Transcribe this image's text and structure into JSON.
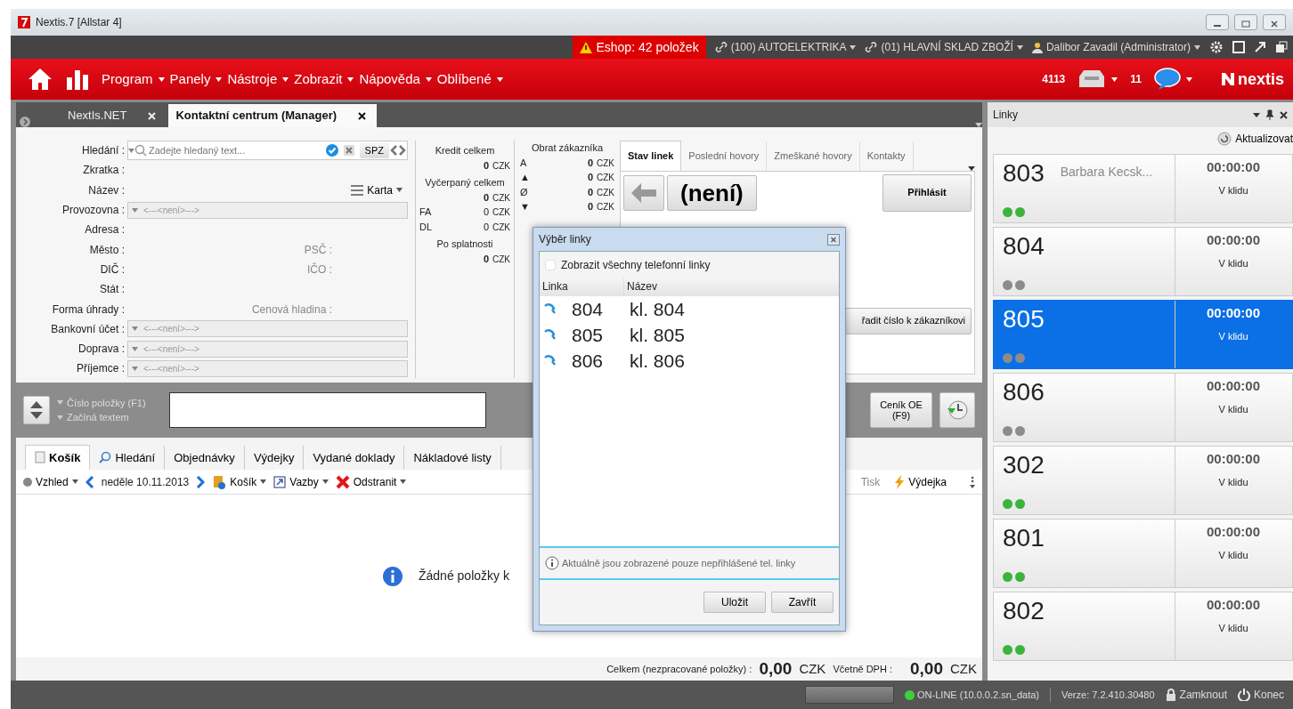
{
  "window": {
    "title": "Nextis.7 [Allstar 4]"
  },
  "top_strip": {
    "eshop": "Eshop: 42 položek",
    "links": [
      "(100) AUTOELEKTRIKA",
      "(01) HLAVNÍ SKLAD ZBOŽÍ"
    ],
    "user": "Dalibor Zavadil (Administrator)"
  },
  "menu": {
    "items": [
      "Program",
      "Panely",
      "Nástroje",
      "Zobrazit",
      "Nápověda",
      "Oblíbené"
    ],
    "counter": "4113",
    "messages": "11",
    "logo": "nextis"
  },
  "doc_tabs": [
    {
      "label": "NextIs.NET",
      "selected": false
    },
    {
      "label": "Kontaktní centrum (Manager)",
      "selected": true
    }
  ],
  "customer_form": {
    "search_label": "Hledání :",
    "search_placeholder": "Zadejte hledaný text...",
    "spz": "SPZ",
    "rows": [
      {
        "label": "Zkratka :",
        "kind": "plain"
      },
      {
        "label": "Název :",
        "kind": "plain",
        "action": "Karta"
      },
      {
        "label": "Provozovna :",
        "kind": "select",
        "value": "<---<není>--->"
      },
      {
        "label": "Adresa :",
        "kind": "plain"
      },
      {
        "label": "Město :",
        "kind": "plain",
        "right_label": "PSČ :"
      },
      {
        "label": "DIČ :",
        "kind": "plain",
        "right_label": "IČO :"
      },
      {
        "label": "Stát :",
        "kind": "plain"
      },
      {
        "label": "Forma úhrady :",
        "kind": "plain",
        "right_label": "Cenová hladina :"
      },
      {
        "label": "Bankovní účet :",
        "kind": "select",
        "value": "<---<není>--->"
      },
      {
        "label": "Doprava :",
        "kind": "select",
        "value": "<---<není>--->"
      },
      {
        "label": "Příjemce :",
        "kind": "select",
        "value": "<---<není>--->"
      }
    ]
  },
  "credit": [
    {
      "kind": "heading",
      "text": "Kredit celkem"
    },
    {
      "kind": "amount",
      "value": "0",
      "currency": "CZK"
    },
    {
      "kind": "heading",
      "text": "Vyčerpaný celkem"
    },
    {
      "kind": "amount",
      "value": "0",
      "currency": "CZK"
    },
    {
      "kind": "labeled",
      "label": "FA",
      "value": "0",
      "currency": "CZK"
    },
    {
      "kind": "labeled",
      "label": "DL",
      "value": "0",
      "currency": "CZK"
    },
    {
      "kind": "heading",
      "text": "Po splatnosti"
    },
    {
      "kind": "amount",
      "value": "0",
      "currency": "CZK"
    }
  ],
  "turnover": {
    "title": "Obrat zákazníka",
    "rows": [
      {
        "label": "A",
        "value": "0",
        "currency": "CZK"
      },
      {
        "label": "▲",
        "value": "0",
        "currency": "CZK"
      },
      {
        "label": "Ø",
        "value": "0",
        "currency": "CZK"
      },
      {
        "label": "▼",
        "value": "0",
        "currency": "CZK"
      }
    ]
  },
  "call_panel": {
    "tabs": [
      {
        "label": "Stav linek",
        "selected": true
      },
      {
        "label": "Poslední hovory",
        "selected": false
      },
      {
        "label": "Zmeškané hovory",
        "selected": false
      },
      {
        "label": "Kontakty",
        "selected": false
      }
    ],
    "line": "(není)",
    "login": "Přihlásit",
    "assign": "řadit číslo k zákazníkovi"
  },
  "item_entry": {
    "modes": [
      "Číslo položky (F1)",
      "Začíná textem"
    ],
    "price_list": "Ceník OE (F9)"
  },
  "bottom_tabs": [
    {
      "label": "Košík",
      "selected": true
    },
    {
      "label": "Hledání",
      "selected": false
    },
    {
      "label": "Objednávky",
      "selected": false
    },
    {
      "label": "Výdejky",
      "selected": false
    },
    {
      "label": "Vydané doklady",
      "selected": false
    },
    {
      "label": "Nákladové listy",
      "selected": false
    }
  ],
  "toolbar": {
    "view": "Vzhled",
    "date": "neděle 10.11.2013",
    "cart": "Košík",
    "links": "Vazby",
    "remove": "Odstranit",
    "print": "Tisk",
    "issue": "Výdejka"
  },
  "empty_message": "Žádné položky k",
  "totals": {
    "label": "Celkem (nezpracované položky) :",
    "amount": "0,00",
    "currency": "CZK",
    "vat_label": "Včetně DPH :",
    "vat_amount": "0,00",
    "vat_currency": "CZK"
  },
  "lines_panel": {
    "title": "Linky",
    "refresh": "Aktualizovat"
  },
  "lines": [
    {
      "number": "803",
      "name": "Barbara Kecsk...",
      "time": "00:00:00",
      "status": "V klidu",
      "color": "#3cb43c",
      "selected": false
    },
    {
      "number": "804",
      "time": "00:00:00",
      "status": "V klidu",
      "color": "#8c8c8c",
      "selected": false
    },
    {
      "number": "805",
      "time": "00:00:00",
      "status": "V klidu",
      "color": "#8c8c8c",
      "selected": true
    },
    {
      "number": "806",
      "time": "00:00:00",
      "status": "V klidu",
      "color": "#8c8c8c",
      "selected": false
    },
    {
      "number": "302",
      "time": "00:00:00",
      "status": "V klidu",
      "color": "#3cb43c",
      "selected": false
    },
    {
      "number": "801",
      "time": "00:00:00",
      "status": "V klidu",
      "color": "#3cb43c",
      "selected": false
    },
    {
      "number": "802",
      "time": "00:00:00",
      "status": "V klidu",
      "color": "#3cb43c",
      "selected": false
    }
  ],
  "dialog": {
    "title": "Výběr linky",
    "show_all": {
      "label": "Zobrazit všechny telefonní linky",
      "checked": false
    },
    "columns": [
      "Linka",
      "Název"
    ],
    "rows": [
      {
        "line": "804",
        "name": "kl. 804"
      },
      {
        "line": "805",
        "name": "kl. 805"
      },
      {
        "line": "806",
        "name": "kl. 806"
      }
    ],
    "info": "Aktuálně jsou zobrazené pouze nepřihlášené tel. linky",
    "buttons": [
      "Uložit",
      "Zavřít"
    ]
  },
  "status_bar": {
    "connection": "ON-LINE (10.0.0.2.sn_data)",
    "online": true,
    "version": "Verze: 7.2.410.30480",
    "lock": "Zamknout",
    "exit": "Konec"
  }
}
